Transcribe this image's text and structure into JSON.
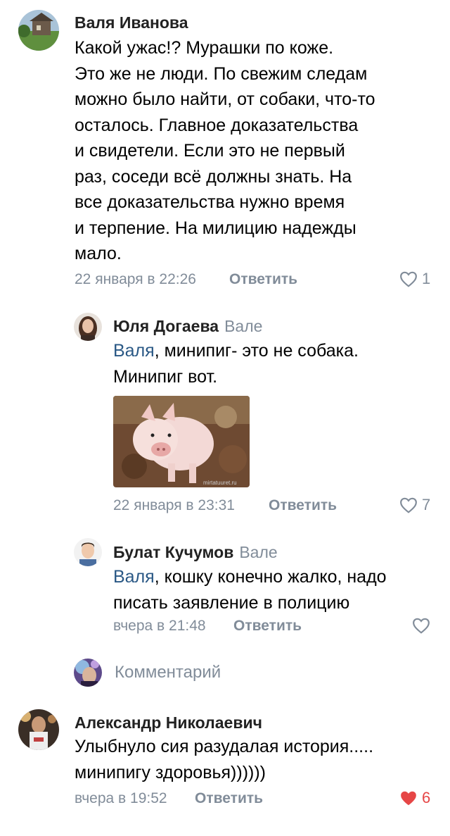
{
  "comments": [
    {
      "author": "Валя Иванова",
      "lines": [
        "Какой ужас!? Мурашки по  коже.",
        "Это же не люди. По свежим следам",
        "можно было найти, от собаки, что-то",
        "осталось. Главное доказательства",
        "и свидетели. Если это не первый",
        "раз, соседи всё  должны знать. На",
        "все доказательства нужно время",
        "и терпение. На милицию надежды",
        "мало."
      ],
      "time": "22 января в 22:26",
      "reply_label": "Ответить",
      "likes": "1"
    },
    {
      "author": "Юля Догаева",
      "reply_to": "Вале",
      "mention": "Валя",
      "line1_rest": ", минипиг- это не собака.",
      "line2": "Минипиг вот.",
      "image_caption": "mirtatuuret.ru",
      "time": "22 января в 23:31",
      "reply_label": "Ответить",
      "likes": "7"
    },
    {
      "author": "Булат Кучумов",
      "reply_to": "Вале",
      "mention": "Валя",
      "line1_rest": ", кошку конечно жалко, надо",
      "line2": "писать заявление в полицию",
      "time": "вчера в 21:48",
      "reply_label": "Ответить",
      "likes": ""
    },
    {
      "author": "Александр Николаевич",
      "lines": [
        "Улыбнуло сия разудалая история.....",
        "минипигу здоровья))))))"
      ],
      "time": "вчера в 19:52",
      "reply_label": "Ответить",
      "likes": "6"
    }
  ],
  "comment_input": {
    "placeholder": "Комментарий"
  },
  "colors": {
    "link": "#2a5885",
    "meta": "#818c99",
    "like_active": "#e64646"
  },
  "icons": {
    "like": "heart-outline-icon",
    "liked": "heart-filled-icon"
  }
}
